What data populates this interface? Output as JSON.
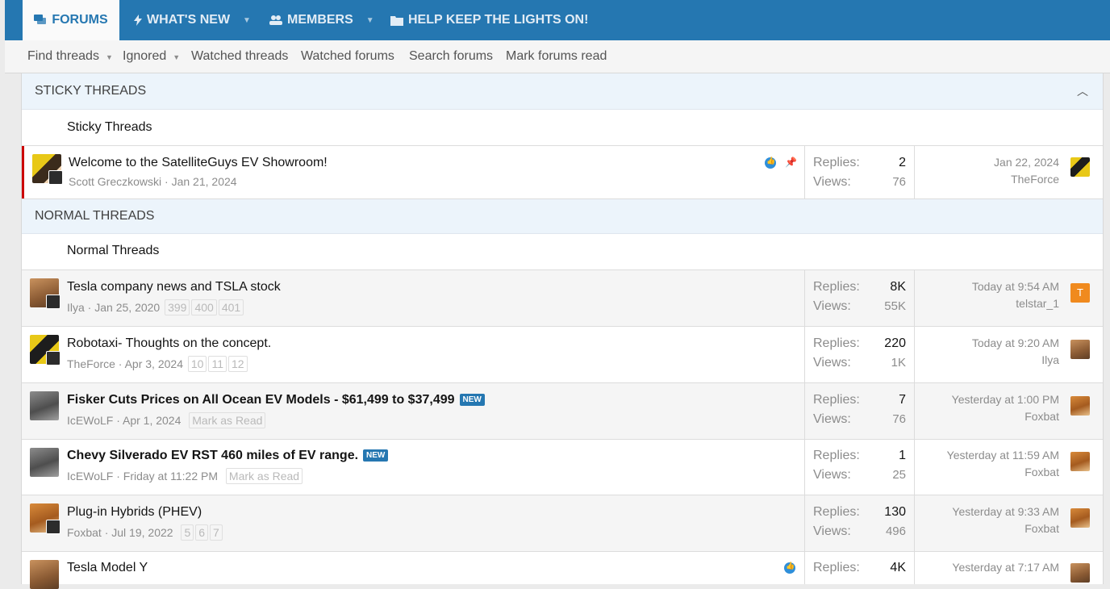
{
  "nav": {
    "tabs": [
      {
        "label": "FORUMS",
        "icon": "comments-icon",
        "active": true
      },
      {
        "label": "WHAT'S NEW",
        "icon": "bolt-icon",
        "active": false
      },
      {
        "label": "MEMBERS",
        "icon": "users-icon",
        "active": false
      },
      {
        "label": "HELP KEEP THE LIGHTS ON!",
        "icon": "folder-icon",
        "active": false
      }
    ]
  },
  "subnav": {
    "items": [
      "Find threads",
      "Ignored",
      "Watched threads",
      "Watched forums",
      "Search forums",
      "Mark forums read"
    ]
  },
  "sections": {
    "sticky": {
      "header": "STICKY THREADS",
      "subheader": "Sticky Threads"
    },
    "normal": {
      "header": "NORMAL THREADS",
      "subheader": "Normal Threads"
    }
  },
  "labels": {
    "replies": "Replies:",
    "views": "Views:"
  },
  "threads": [
    {
      "title": "Welcome to the SatelliteGuys EV Showroom!",
      "author": "Scott Greczkowski",
      "date": "Jan 21, 2024",
      "pages": [],
      "mark_read": "",
      "new": false,
      "replies": "2",
      "views": "76",
      "last_date": "Jan 22, 2024",
      "last_user": "TheForce"
    },
    {
      "title": "Tesla company news and TSLA stock",
      "author": "Ilya",
      "date": "Jan 25, 2020",
      "pages": [
        "399",
        "400",
        "401"
      ],
      "mark_read": "",
      "new": false,
      "replies": "8K",
      "views": "55K",
      "last_date": "Today at 9:54 AM",
      "last_user": "telstar_1",
      "last_avatar_letter": "T"
    },
    {
      "title": "Robotaxi- Thoughts on the concept.",
      "author": "TheForce",
      "date": "Apr 3, 2024",
      "pages": [
        "10",
        "11",
        "12"
      ],
      "mark_read": "",
      "new": false,
      "replies": "220",
      "views": "1K",
      "last_date": "Today at 9:20 AM",
      "last_user": "Ilya"
    },
    {
      "title": "Fisker Cuts Prices on All Ocean EV Models - $61,499 to $37,499",
      "author": "IcEWoLF",
      "date": "Apr 1, 2024",
      "pages": [],
      "mark_read": "Mark as Read",
      "new": true,
      "new_label": "NEW",
      "replies": "7",
      "views": "76",
      "last_date": "Yesterday at 1:00 PM",
      "last_user": "Foxbat"
    },
    {
      "title": "Chevy Silverado EV RST 460 miles of EV range.",
      "author": "IcEWoLF",
      "date": "Friday at 11:22 PM",
      "pages": [],
      "mark_read": "Mark as Read",
      "new": true,
      "new_label": "NEW",
      "replies": "1",
      "views": "25",
      "last_date": "Yesterday at 11:59 AM",
      "last_user": "Foxbat"
    },
    {
      "title": "Plug-in Hybrids (PHEV)",
      "author": "Foxbat",
      "date": "Jul 19, 2022",
      "pages": [
        "5",
        "6",
        "7"
      ],
      "mark_read": "",
      "new": false,
      "replies": "130",
      "views": "496",
      "last_date": "Yesterday at 9:33 AM",
      "last_user": "Foxbat"
    },
    {
      "title": "Tesla Model Y",
      "author": "",
      "date": "",
      "pages": [],
      "mark_read": "",
      "new": false,
      "replies": "4K",
      "views": "",
      "last_date": "Yesterday at 7:17 AM",
      "last_user": ""
    }
  ],
  "colors": {
    "accent": "#2577b1",
    "sticky_bar": "#cc0000",
    "section_bg": "#ecf4fb"
  }
}
